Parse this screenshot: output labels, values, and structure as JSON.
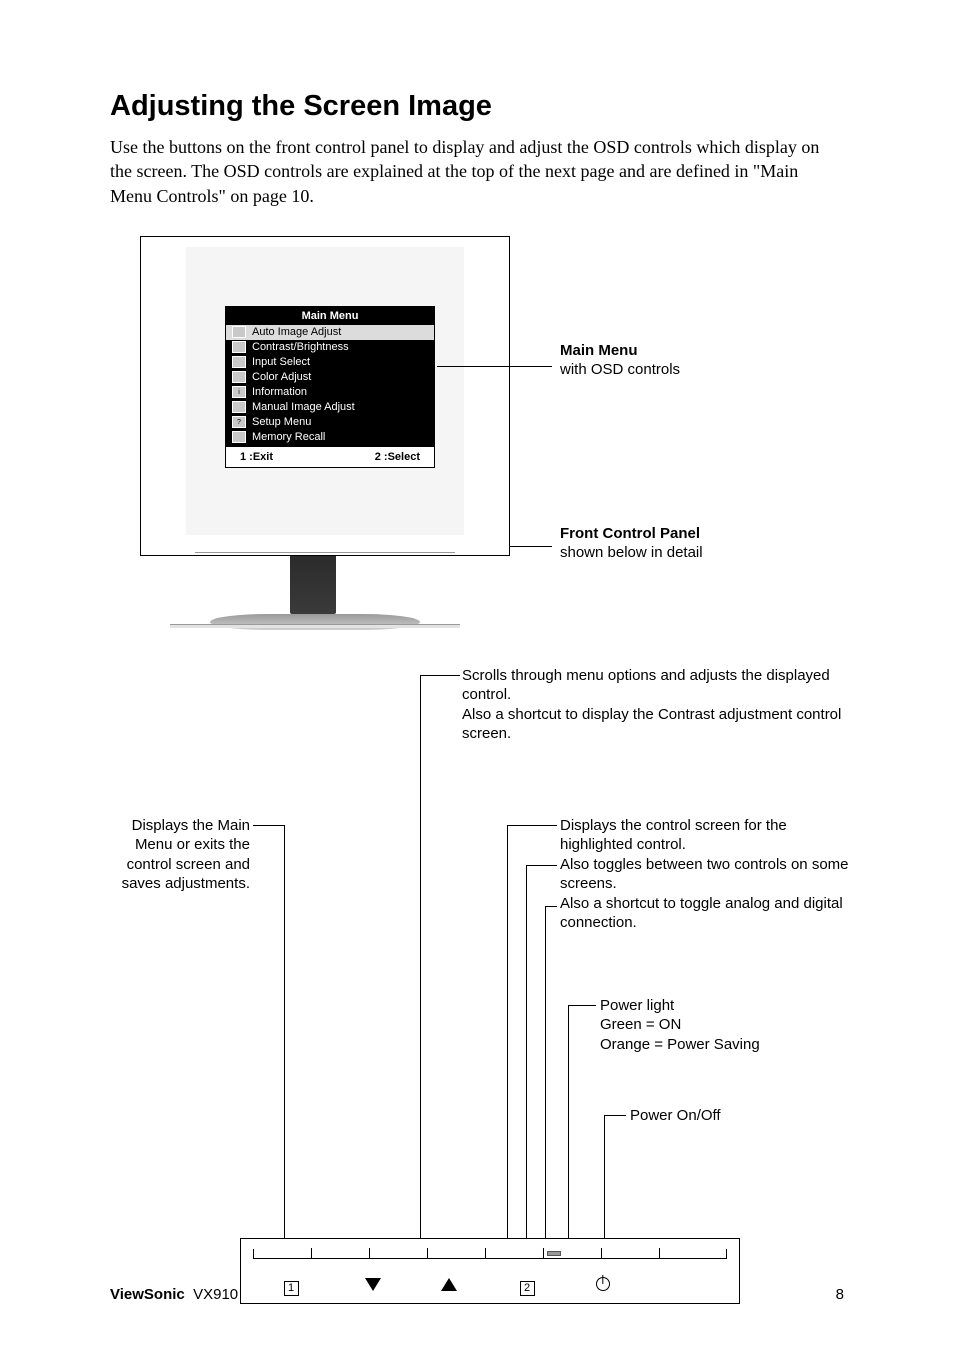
{
  "heading": "Adjusting the Screen Image",
  "intro": "Use the buttons on the front control panel to display and adjust the OSD controls which display on the screen. The OSD controls are explained at the top of the next page and are defined in \"Main Menu Controls\" on page 10.",
  "osd": {
    "title": "Main Menu",
    "items": [
      "Auto Image Adjust",
      "Contrast/Brightness",
      "Input Select",
      "Color Adjust",
      "Information",
      "Manual Image Adjust",
      "Setup Menu",
      "Memory Recall"
    ],
    "footer_left": "1 :Exit",
    "footer_right": "2 :Select"
  },
  "callouts": {
    "main_menu_title": "Main Menu",
    "main_menu_desc": "with OSD controls",
    "front_panel_title": "Front Control Panel",
    "front_panel_desc": "shown below in detail",
    "scroll_line1": "Scrolls through menu options and adjusts the displayed control.",
    "scroll_line2": "Also a shortcut to display the Contrast adjustment control screen.",
    "btn1": "Displays the Main Menu or exits the control screen and saves adjustments.",
    "btn2a": "Displays the control screen for the highlighted control.",
    "btn2b": "Also toggles between two controls on some screens.",
    "btn2c": "Also a shortcut to toggle analog and digital connection.",
    "power_light_title": "Power light",
    "power_light_on": "Green = ON",
    "power_light_save": "Orange = Power Saving",
    "power_onoff": "Power On/Off"
  },
  "footer_brand": "ViewSonic",
  "footer_model": "VX910",
  "page_number": "8"
}
